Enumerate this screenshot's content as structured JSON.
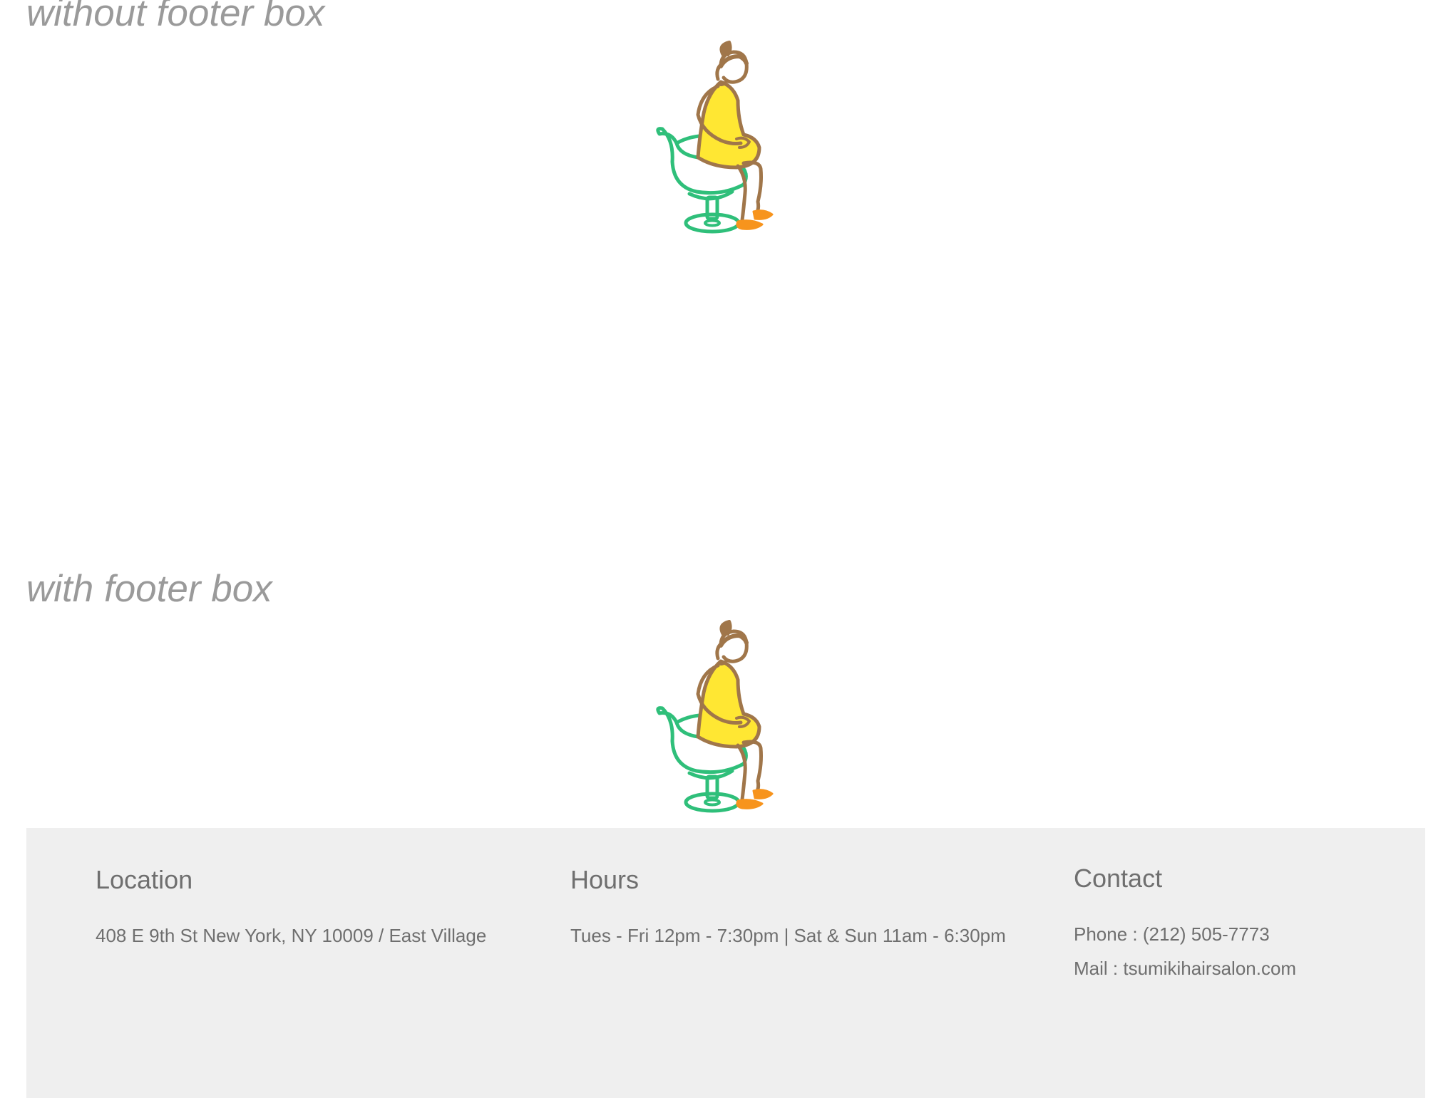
{
  "labels": {
    "without": "without footer box",
    "with": "with footer box"
  },
  "illustration": {
    "icon": "woman-sitting-on-salon-chair-illustration",
    "colors": {
      "outline": "#a0764a",
      "dress": "#ffe733",
      "chair": "#2fbf7a",
      "shoes": "#f7941d",
      "skin": "#ffffff"
    }
  },
  "footer": {
    "background": "#efefef",
    "text_color": "#6f6f6f",
    "location": {
      "heading": "Location",
      "address": "408 E 9th St New York, NY 10009 / East Village"
    },
    "hours": {
      "heading": "Hours",
      "schedule": "Tues - Fri 12pm - 7:30pm | Sat & Sun 11am - 6:30pm"
    },
    "contact": {
      "heading": "Contact",
      "phone": "Phone : (212) 505-7773",
      "mail": "Mail : tsumikihairsalon.com"
    }
  }
}
